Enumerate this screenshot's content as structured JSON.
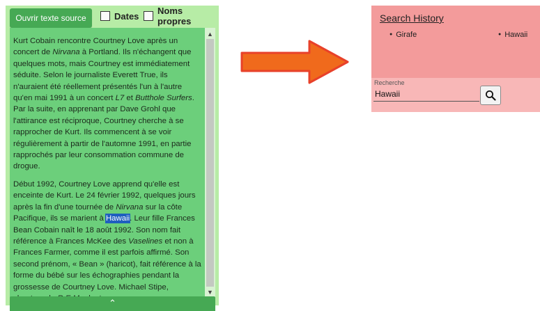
{
  "left_panel": {
    "open_button_label": "Ouvrir texte source",
    "checkboxes": [
      {
        "label": "Dates",
        "checked": false
      },
      {
        "label": "Noms propres",
        "checked": false
      }
    ],
    "paragraphs": [
      [
        {
          "t": "Kurt Cobain rencontre Courtney Love après un concert de "
        },
        {
          "t": "Nirvana",
          "i": true
        },
        {
          "t": " à Portland. Ils n'échangent que quelques mots, mais Courtney est immédiatement séduite. Selon le journaliste Everett True, ils n'auraient été réellement présentés l'un à l'autre qu'en mai 1991 à un concert "
        },
        {
          "t": "L7",
          "i": true
        },
        {
          "t": " et "
        },
        {
          "t": "Butthole Surfers",
          "i": true
        },
        {
          "t": ". Par la suite, en apprenant par Dave Grohl que l'attirance est réciproque, Courtney cherche à se rapprocher de Kurt. Ils commencent à se voir régulièrement à partir de l'automne 1991, en partie rapprochés par leur consommation commune de drogue."
        }
      ],
      [
        {
          "t": "Début 1992, Courtney Love apprend qu'elle est enceinte de Kurt. Le 24 février 1992, quelques jours après la fin d'une tournée de "
        },
        {
          "t": "Nirvana",
          "i": true
        },
        {
          "t": " sur la côte Pacifique, ils se marient à "
        },
        {
          "t": "Hawaii",
          "hl": true
        },
        {
          "t": ". Leur fille Frances Bean Cobain naît le 18 août 1992. Son nom fait référence à Frances McKee des "
        },
        {
          "t": "Vaselines",
          "i": true
        },
        {
          "t": " et non à Frances Farmer, comme il est parfois affirmé. Son second prénom, « Bean » (haricot), fait référence à la forme du bébé sur les échographies pendant la grossesse de Courtney Love. Michael Stipe, chanteur de "
        },
        {
          "t": "R.E.M.",
          "i": true
        },
        {
          "t": ", dont"
        }
      ]
    ],
    "scroll_up_glyph": "▲",
    "scroll_down_glyph": "▼",
    "collapse_glyph": "⌃"
  },
  "right_panel": {
    "title": "Search History",
    "history": [
      "Girafe",
      "Hawaii"
    ],
    "search": {
      "label": "Recherche",
      "value": "Hawaii"
    }
  },
  "colors": {
    "panel_bg": "#b7eca6",
    "text_bg": "#6ccf7b",
    "button_green": "#46a954",
    "arrow_fill": "#f06a1c",
    "arrow_stroke": "#e8412a",
    "history_bg": "#f39b9b",
    "search_bg": "#f8b7b7",
    "highlight": "#1f5fbf"
  },
  "icons": {
    "arrow": "right-arrow-icon",
    "search": "magnifier-icon"
  }
}
